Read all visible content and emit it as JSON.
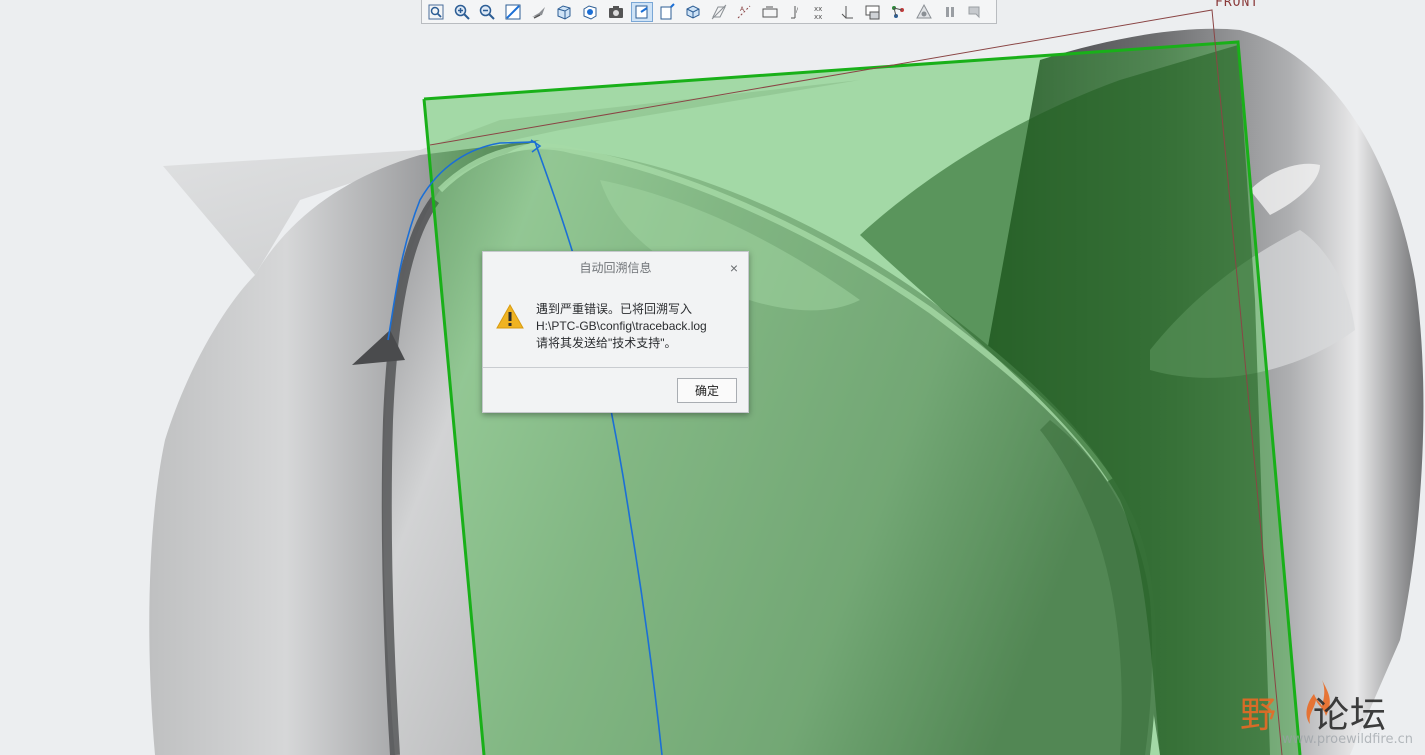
{
  "viewport": {
    "datum_plane_label": "FRONT"
  },
  "toolbar": {
    "items": [
      {
        "name": "refit-icon",
        "active": false
      },
      {
        "name": "zoom-in-icon",
        "active": false
      },
      {
        "name": "zoom-out-icon",
        "active": false
      },
      {
        "name": "repaint-icon",
        "active": false
      },
      {
        "name": "perspective-icon",
        "active": false
      },
      {
        "name": "shading-icon",
        "active": false
      },
      {
        "name": "display-style-icon",
        "active": false
      },
      {
        "name": "saved-views-icon",
        "active": false
      },
      {
        "name": "view-manager-icon",
        "active": true
      },
      {
        "name": "view-normal-icon",
        "active": false
      },
      {
        "name": "orient-icon",
        "active": false
      },
      {
        "name": "plane-display-icon",
        "active": false
      },
      {
        "name": "axis-display-icon",
        "active": false
      },
      {
        "name": "point-display-icon",
        "active": false
      },
      {
        "name": "csys-display-icon",
        "active": false
      },
      {
        "name": "point-tag-icon",
        "active": false
      },
      {
        "name": "csys-tag-icon",
        "active": false
      },
      {
        "name": "annotation-display-icon",
        "active": false
      },
      {
        "name": "spin-center-icon",
        "active": false
      },
      {
        "name": "render-icon",
        "active": false
      },
      {
        "name": "pause-icon",
        "active": false
      },
      {
        "name": "next-icon",
        "active": false
      }
    ]
  },
  "dialog": {
    "title": "自动回溯信息",
    "close_glyph": "×",
    "message_line1": "遇到严重错误。已将回溯写入",
    "message_line2": "H:\\PTC-GB\\config\\traceback.log",
    "message_line3": "请将其发送给\"技术支持\"。",
    "ok_label": "确定"
  },
  "watermark": {
    "text_part1": "野",
    "text_part2": "论坛",
    "url": "www.proewildfire.cn"
  },
  "colors": {
    "background": "#eceef0",
    "plane_green": "#1db31d",
    "curve_blue": "#1b6fd6",
    "warning_yellow": "#f0b321",
    "watermark_orange": "#e96a25"
  }
}
